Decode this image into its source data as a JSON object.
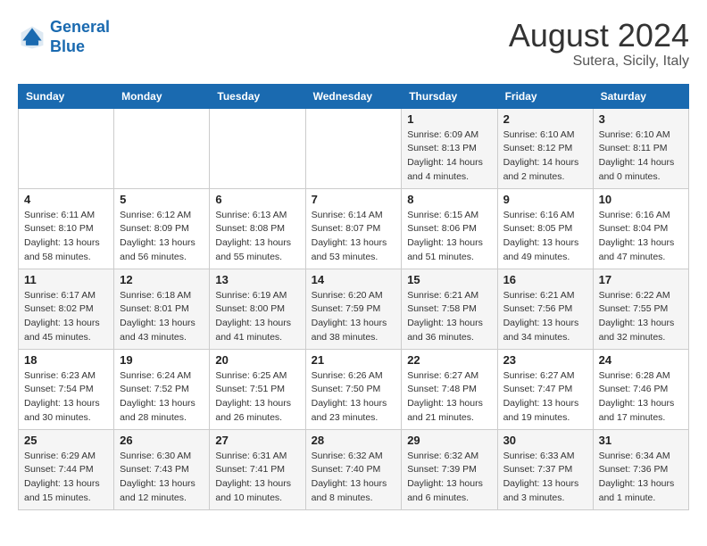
{
  "header": {
    "logo_line1": "General",
    "logo_line2": "Blue",
    "month_year": "August 2024",
    "location": "Sutera, Sicily, Italy"
  },
  "days_of_week": [
    "Sunday",
    "Monday",
    "Tuesday",
    "Wednesday",
    "Thursday",
    "Friday",
    "Saturday"
  ],
  "weeks": [
    [
      {
        "num": "",
        "info": ""
      },
      {
        "num": "",
        "info": ""
      },
      {
        "num": "",
        "info": ""
      },
      {
        "num": "",
        "info": ""
      },
      {
        "num": "1",
        "sunrise": "Sunrise: 6:09 AM",
        "sunset": "Sunset: 8:13 PM",
        "daylight": "Daylight: 14 hours and 4 minutes."
      },
      {
        "num": "2",
        "sunrise": "Sunrise: 6:10 AM",
        "sunset": "Sunset: 8:12 PM",
        "daylight": "Daylight: 14 hours and 2 minutes."
      },
      {
        "num": "3",
        "sunrise": "Sunrise: 6:10 AM",
        "sunset": "Sunset: 8:11 PM",
        "daylight": "Daylight: 14 hours and 0 minutes."
      }
    ],
    [
      {
        "num": "4",
        "sunrise": "Sunrise: 6:11 AM",
        "sunset": "Sunset: 8:10 PM",
        "daylight": "Daylight: 13 hours and 58 minutes."
      },
      {
        "num": "5",
        "sunrise": "Sunrise: 6:12 AM",
        "sunset": "Sunset: 8:09 PM",
        "daylight": "Daylight: 13 hours and 56 minutes."
      },
      {
        "num": "6",
        "sunrise": "Sunrise: 6:13 AM",
        "sunset": "Sunset: 8:08 PM",
        "daylight": "Daylight: 13 hours and 55 minutes."
      },
      {
        "num": "7",
        "sunrise": "Sunrise: 6:14 AM",
        "sunset": "Sunset: 8:07 PM",
        "daylight": "Daylight: 13 hours and 53 minutes."
      },
      {
        "num": "8",
        "sunrise": "Sunrise: 6:15 AM",
        "sunset": "Sunset: 8:06 PM",
        "daylight": "Daylight: 13 hours and 51 minutes."
      },
      {
        "num": "9",
        "sunrise": "Sunrise: 6:16 AM",
        "sunset": "Sunset: 8:05 PM",
        "daylight": "Daylight: 13 hours and 49 minutes."
      },
      {
        "num": "10",
        "sunrise": "Sunrise: 6:16 AM",
        "sunset": "Sunset: 8:04 PM",
        "daylight": "Daylight: 13 hours and 47 minutes."
      }
    ],
    [
      {
        "num": "11",
        "sunrise": "Sunrise: 6:17 AM",
        "sunset": "Sunset: 8:02 PM",
        "daylight": "Daylight: 13 hours and 45 minutes."
      },
      {
        "num": "12",
        "sunrise": "Sunrise: 6:18 AM",
        "sunset": "Sunset: 8:01 PM",
        "daylight": "Daylight: 13 hours and 43 minutes."
      },
      {
        "num": "13",
        "sunrise": "Sunrise: 6:19 AM",
        "sunset": "Sunset: 8:00 PM",
        "daylight": "Daylight: 13 hours and 41 minutes."
      },
      {
        "num": "14",
        "sunrise": "Sunrise: 6:20 AM",
        "sunset": "Sunset: 7:59 PM",
        "daylight": "Daylight: 13 hours and 38 minutes."
      },
      {
        "num": "15",
        "sunrise": "Sunrise: 6:21 AM",
        "sunset": "Sunset: 7:58 PM",
        "daylight": "Daylight: 13 hours and 36 minutes."
      },
      {
        "num": "16",
        "sunrise": "Sunrise: 6:21 AM",
        "sunset": "Sunset: 7:56 PM",
        "daylight": "Daylight: 13 hours and 34 minutes."
      },
      {
        "num": "17",
        "sunrise": "Sunrise: 6:22 AM",
        "sunset": "Sunset: 7:55 PM",
        "daylight": "Daylight: 13 hours and 32 minutes."
      }
    ],
    [
      {
        "num": "18",
        "sunrise": "Sunrise: 6:23 AM",
        "sunset": "Sunset: 7:54 PM",
        "daylight": "Daylight: 13 hours and 30 minutes."
      },
      {
        "num": "19",
        "sunrise": "Sunrise: 6:24 AM",
        "sunset": "Sunset: 7:52 PM",
        "daylight": "Daylight: 13 hours and 28 minutes."
      },
      {
        "num": "20",
        "sunrise": "Sunrise: 6:25 AM",
        "sunset": "Sunset: 7:51 PM",
        "daylight": "Daylight: 13 hours and 26 minutes."
      },
      {
        "num": "21",
        "sunrise": "Sunrise: 6:26 AM",
        "sunset": "Sunset: 7:50 PM",
        "daylight": "Daylight: 13 hours and 23 minutes."
      },
      {
        "num": "22",
        "sunrise": "Sunrise: 6:27 AM",
        "sunset": "Sunset: 7:48 PM",
        "daylight": "Daylight: 13 hours and 21 minutes."
      },
      {
        "num": "23",
        "sunrise": "Sunrise: 6:27 AM",
        "sunset": "Sunset: 7:47 PM",
        "daylight": "Daylight: 13 hours and 19 minutes."
      },
      {
        "num": "24",
        "sunrise": "Sunrise: 6:28 AM",
        "sunset": "Sunset: 7:46 PM",
        "daylight": "Daylight: 13 hours and 17 minutes."
      }
    ],
    [
      {
        "num": "25",
        "sunrise": "Sunrise: 6:29 AM",
        "sunset": "Sunset: 7:44 PM",
        "daylight": "Daylight: 13 hours and 15 minutes."
      },
      {
        "num": "26",
        "sunrise": "Sunrise: 6:30 AM",
        "sunset": "Sunset: 7:43 PM",
        "daylight": "Daylight: 13 hours and 12 minutes."
      },
      {
        "num": "27",
        "sunrise": "Sunrise: 6:31 AM",
        "sunset": "Sunset: 7:41 PM",
        "daylight": "Daylight: 13 hours and 10 minutes."
      },
      {
        "num": "28",
        "sunrise": "Sunrise: 6:32 AM",
        "sunset": "Sunset: 7:40 PM",
        "daylight": "Daylight: 13 hours and 8 minutes."
      },
      {
        "num": "29",
        "sunrise": "Sunrise: 6:32 AM",
        "sunset": "Sunset: 7:39 PM",
        "daylight": "Daylight: 13 hours and 6 minutes."
      },
      {
        "num": "30",
        "sunrise": "Sunrise: 6:33 AM",
        "sunset": "Sunset: 7:37 PM",
        "daylight": "Daylight: 13 hours and 3 minutes."
      },
      {
        "num": "31",
        "sunrise": "Sunrise: 6:34 AM",
        "sunset": "Sunset: 7:36 PM",
        "daylight": "Daylight: 13 hours and 1 minute."
      }
    ]
  ]
}
